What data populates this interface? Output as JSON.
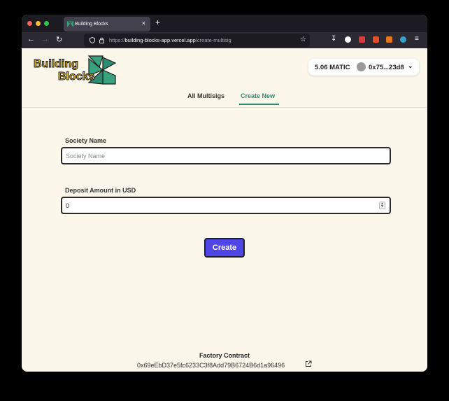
{
  "browser": {
    "tab_title": "Building Blocks",
    "tab_close": "×",
    "new_tab": "+",
    "url_scheme": "https://",
    "url_host": "building-blocks-app.vercel.app",
    "url_path": "/create-multisig"
  },
  "header": {
    "logo_text_line1": "Building",
    "logo_text_line2": "Blocks",
    "wallet_balance": "5.06 MATIC",
    "wallet_address": "0x75...23d8"
  },
  "tabs": [
    {
      "label": "All Multisigs"
    },
    {
      "label": "Create New"
    }
  ],
  "form": {
    "society_label": "Society Name",
    "society_placeholder": "Society Name",
    "society_value": "",
    "deposit_label": "Deposit Amount in USD",
    "deposit_value": "0",
    "create_label": "Create"
  },
  "footer": {
    "title": "Factory Contract",
    "address": "0x69eEbD37e5fc6233C3f8Add79B6724B6d1a96496"
  },
  "colors": {
    "accent_green": "#2e8b72",
    "button_purple": "#4f46e5",
    "page_bg": "#fbf7ea"
  }
}
